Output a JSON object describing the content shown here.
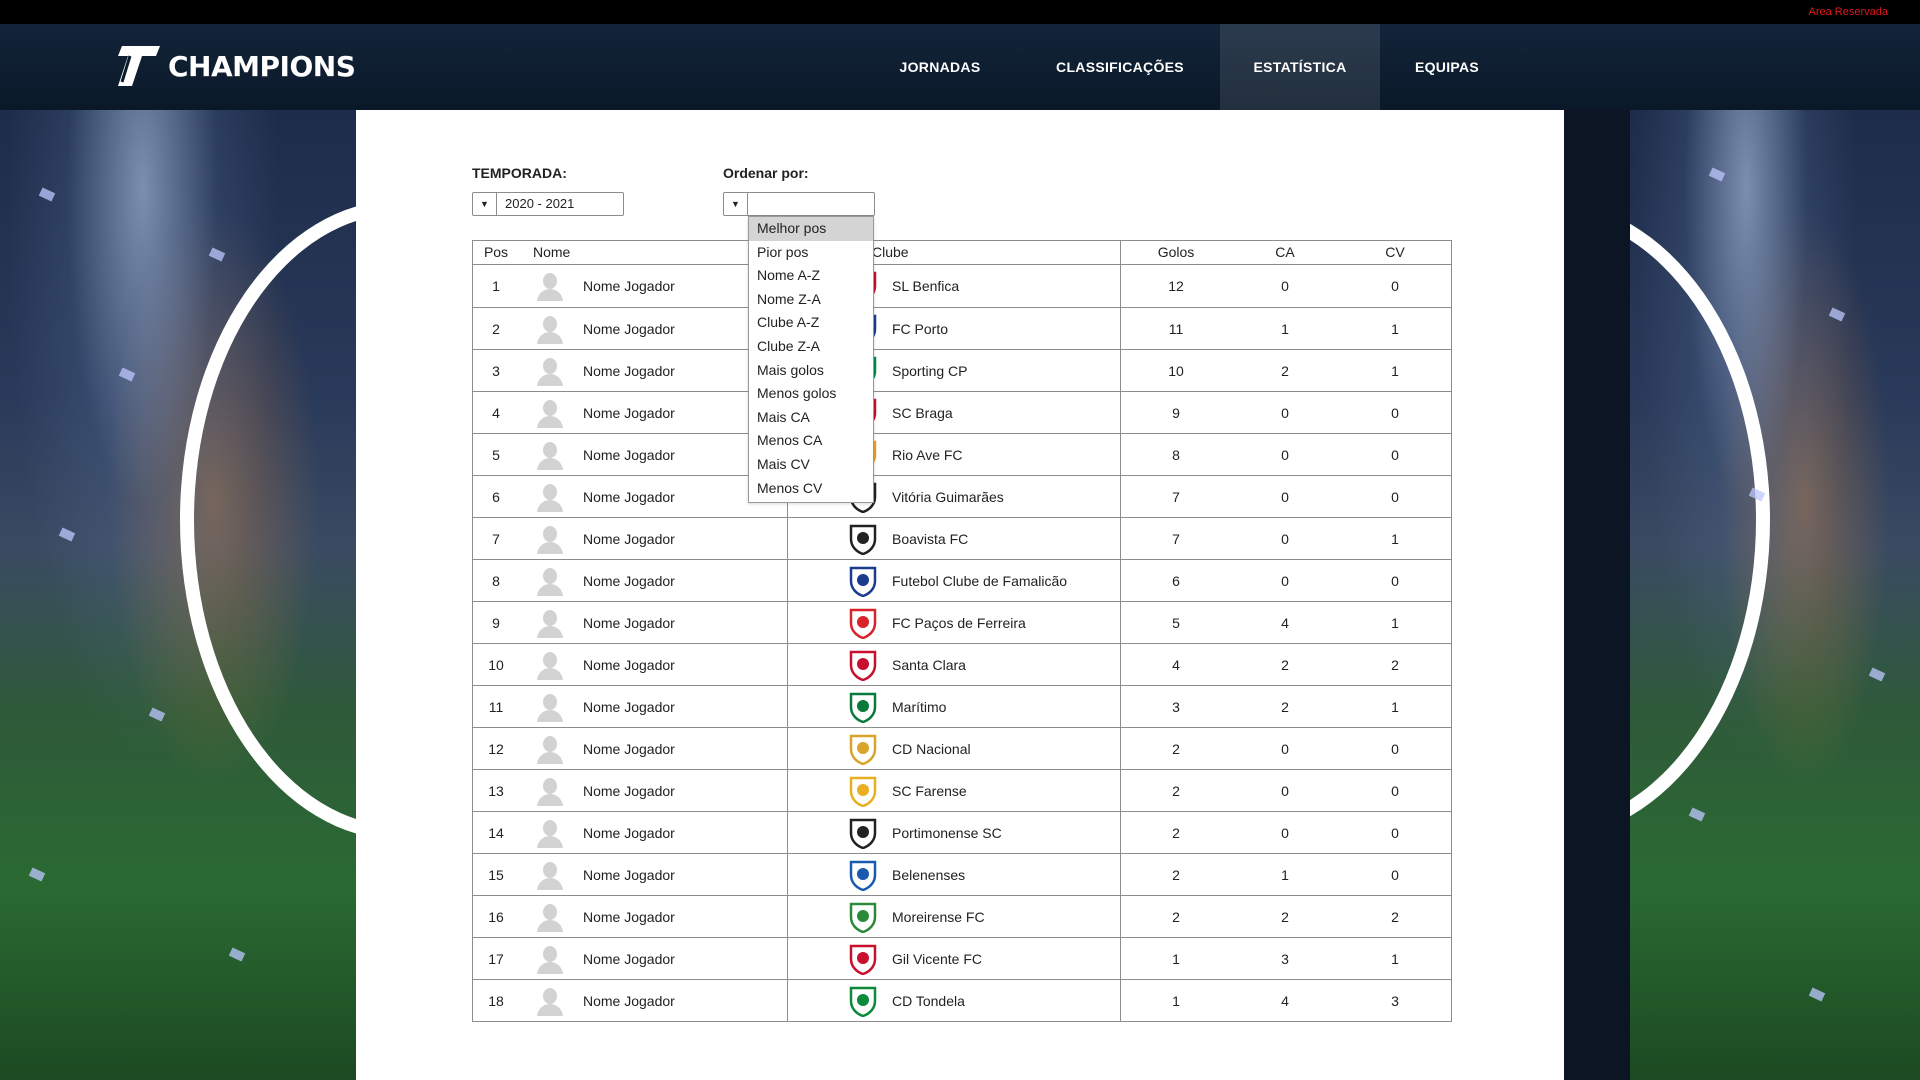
{
  "topbar": {
    "reserved_link": "Area Reservada"
  },
  "header": {
    "logo_text": "CHAMPIONS",
    "nav": [
      {
        "label": "JORNADAS",
        "active": false
      },
      {
        "label": "CLASSIFICAÇÕES",
        "active": false
      },
      {
        "label": "ESTATÍSTICA",
        "active": true
      },
      {
        "label": "EQUIPAS",
        "active": false
      }
    ]
  },
  "filters": {
    "season_label": "TEMPORADA:",
    "season_value": "2020 - 2021",
    "order_label": "Ordenar por:",
    "order_value": "",
    "order_options": [
      "Melhor pos",
      "Pior pos",
      "Nome A-Z",
      "Nome Z-A",
      "Clube A-Z",
      "Clube Z-A",
      "Mais golos",
      "Menos golos",
      "Mais CA",
      "Menos CA",
      "Mais CV",
      "Menos CV"
    ],
    "order_highlighted": "Melhor pos"
  },
  "table": {
    "headers": {
      "pos": "Pos",
      "name": "Nome",
      "club": "Clube",
      "goals": "Golos",
      "ca": "CA",
      "cv": "CV"
    },
    "rows": [
      {
        "pos": "1",
        "name": "Nome Jogador",
        "club": "SL Benfica",
        "goals": "12",
        "ca": "0",
        "cv": "0",
        "crest_color": "#c8102e"
      },
      {
        "pos": "2",
        "name": "Nome Jogador",
        "club": "FC Porto",
        "goals": "11",
        "ca": "1",
        "cv": "1",
        "crest_color": "#1a3b8e"
      },
      {
        "pos": "3",
        "name": "Nome Jogador",
        "club": "Sporting CP",
        "goals": "10",
        "ca": "2",
        "cv": "1",
        "crest_color": "#008a4a"
      },
      {
        "pos": "4",
        "name": "Nome Jogador",
        "club": "SC Braga",
        "goals": "9",
        "ca": "0",
        "cv": "0",
        "crest_color": "#c8102e"
      },
      {
        "pos": "5",
        "name": "Nome Jogador",
        "club": "Rio Ave FC",
        "goals": "8",
        "ca": "0",
        "cv": "0",
        "crest_color": "#e8a02a"
      },
      {
        "pos": "6",
        "name": "Nome Jogador",
        "club": "Vitória Guimarães",
        "goals": "7",
        "ca": "0",
        "cv": "0",
        "crest_color": "#222222"
      },
      {
        "pos": "7",
        "name": "Nome Jogador",
        "club": "Boavista FC",
        "goals": "7",
        "ca": "0",
        "cv": "1",
        "crest_color": "#222222"
      },
      {
        "pos": "8",
        "name": "Nome Jogador",
        "club": "Futebol Clube de Famalicão",
        "goals": "6",
        "ca": "0",
        "cv": "0",
        "crest_color": "#1a3b8e"
      },
      {
        "pos": "9",
        "name": "Nome Jogador",
        "club": "FC Paços de Ferreira",
        "goals": "5",
        "ca": "4",
        "cv": "1",
        "crest_color": "#d8232a"
      },
      {
        "pos": "10",
        "name": "Nome Jogador",
        "club": "Santa Clara",
        "goals": "4",
        "ca": "2",
        "cv": "2",
        "crest_color": "#c8102e"
      },
      {
        "pos": "11",
        "name": "Nome Jogador",
        "club": "Marítimo",
        "goals": "3",
        "ca": "2",
        "cv": "1",
        "crest_color": "#0a7a3a"
      },
      {
        "pos": "12",
        "name": "Nome Jogador",
        "club": "CD Nacional",
        "goals": "2",
        "ca": "0",
        "cv": "0",
        "crest_color": "#d8a52a"
      },
      {
        "pos": "13",
        "name": "Nome Jogador",
        "club": "SC Farense",
        "goals": "2",
        "ca": "0",
        "cv": "0",
        "crest_color": "#e8b020"
      },
      {
        "pos": "14",
        "name": "Nome Jogador",
        "club": "Portimonense SC",
        "goals": "2",
        "ca": "0",
        "cv": "0",
        "crest_color": "#222222"
      },
      {
        "pos": "15",
        "name": "Nome Jogador",
        "club": "Belenenses",
        "goals": "2",
        "ca": "1",
        "cv": "0",
        "crest_color": "#1a5bb0"
      },
      {
        "pos": "16",
        "name": "Nome Jogador",
        "club": "Moreirense FC",
        "goals": "2",
        "ca": "2",
        "cv": "2",
        "crest_color": "#2a8a3a"
      },
      {
        "pos": "17",
        "name": "Nome Jogador",
        "club": "Gil Vicente FC",
        "goals": "1",
        "ca": "3",
        "cv": "1",
        "crest_color": "#c8102e"
      },
      {
        "pos": "18",
        "name": "Nome Jogador",
        "club": "CD Tondela",
        "goals": "1",
        "ca": "4",
        "cv": "3",
        "crest_color": "#0a8a3a"
      }
    ]
  }
}
